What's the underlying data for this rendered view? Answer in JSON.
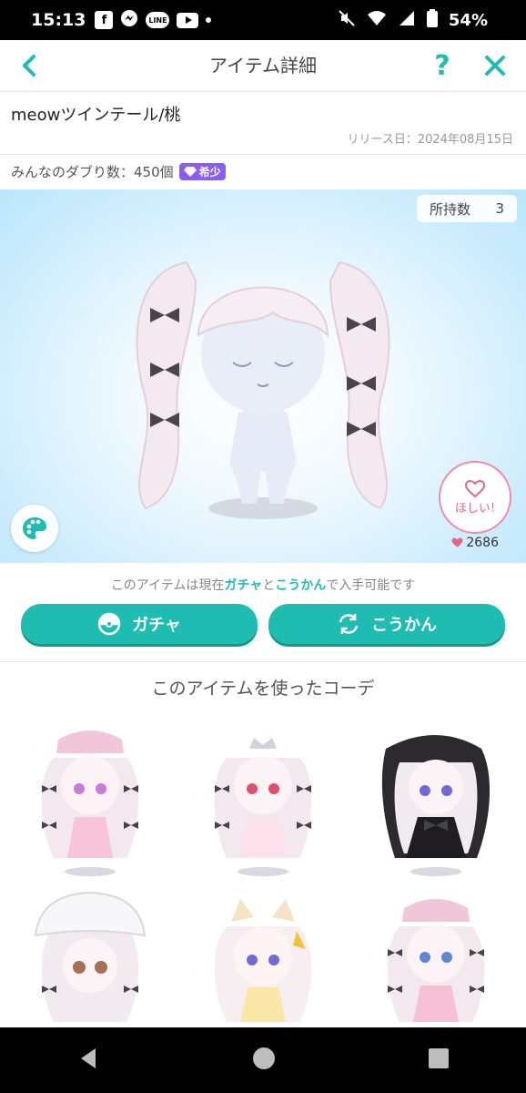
{
  "status_bar": {
    "time": "15:13",
    "fb_icon": "facebook-icon",
    "line_label": "LINE",
    "battery_percent": "54%"
  },
  "header": {
    "title": "アイテム詳細",
    "back_icon": "chevron-left-icon",
    "help_label": "?",
    "close_icon": "close-icon"
  },
  "item": {
    "name": "meowツインテール/桃",
    "release_date": "リリース日：2024年08月15日",
    "duplicates_text": "みんなのダブり数：450個",
    "rarity_label": "希少"
  },
  "preview": {
    "owned_label": "所持数",
    "owned_count": "3",
    "want_label": "ほしい!",
    "want_count": "2686"
  },
  "availability": {
    "prefix": "このアイテムは現在",
    "gacha": "ガチャ",
    "and": "と",
    "exchange": "こうかん",
    "suffix": "で入手可能です"
  },
  "buttons": {
    "gacha": "ガチャ",
    "exchange": "こうかん"
  },
  "coordinates": {
    "title": "このアイテムを使ったコーデ",
    "items": [
      {
        "name": "coordinate-1-pink-maid"
      },
      {
        "name": "coordinate-2-tiara"
      },
      {
        "name": "coordinate-3-black-gothic"
      },
      {
        "name": "coordinate-4-white-hat"
      },
      {
        "name": "coordinate-5-yellow-cat"
      },
      {
        "name": "coordinate-6-pink-lace"
      }
    ]
  },
  "colors": {
    "accent": "#1fbdb1",
    "pink": "#e8628a",
    "rare": "#8b5cf6",
    "preview_bg": "#b9e6fb"
  }
}
